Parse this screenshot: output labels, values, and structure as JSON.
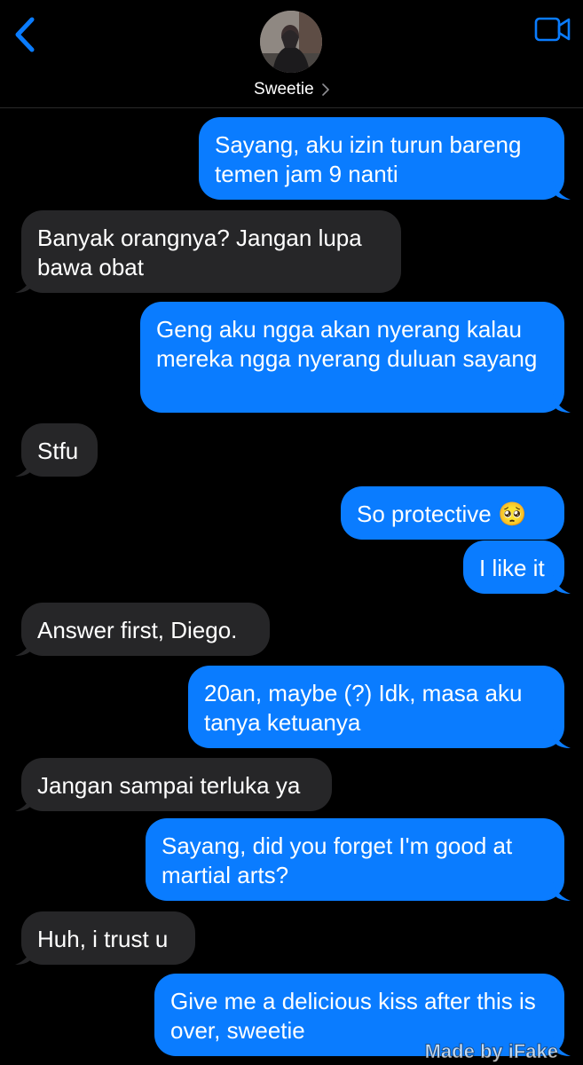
{
  "header": {
    "contact_name": "Sweetie",
    "back_icon": "chevron-left-icon",
    "video_icon": "video-camera-icon",
    "accent_color": "#0a7cff"
  },
  "messages": [
    {
      "side": "sent",
      "text": "Sayang, aku izin turun bareng temen jam 9 nanti"
    },
    {
      "side": "received",
      "text": "Banyak orangnya? Jangan lupa bawa obat"
    },
    {
      "side": "sent",
      "text": "Geng aku ngga akan nyerang kalau mereka ngga nyerang duluan sayang"
    },
    {
      "side": "received",
      "text": "Stfu"
    },
    {
      "side": "sent",
      "text": "So protective 🥺"
    },
    {
      "side": "sent",
      "text": "I like it"
    },
    {
      "side": "received",
      "text": "Answer first, Diego."
    },
    {
      "side": "sent",
      "text": "20an, maybe (?) Idk, masa aku tanya ketuanya"
    },
    {
      "side": "received",
      "text": "Jangan sampai terluka ya"
    },
    {
      "side": "sent",
      "text": "Sayang, did you forget I'm good at martial arts?"
    },
    {
      "side": "received",
      "text": "Huh, i trust u"
    },
    {
      "side": "sent",
      "text": "Give me a delicious kiss after this is over, sweetie"
    }
  ],
  "watermark": "Made by iFake"
}
